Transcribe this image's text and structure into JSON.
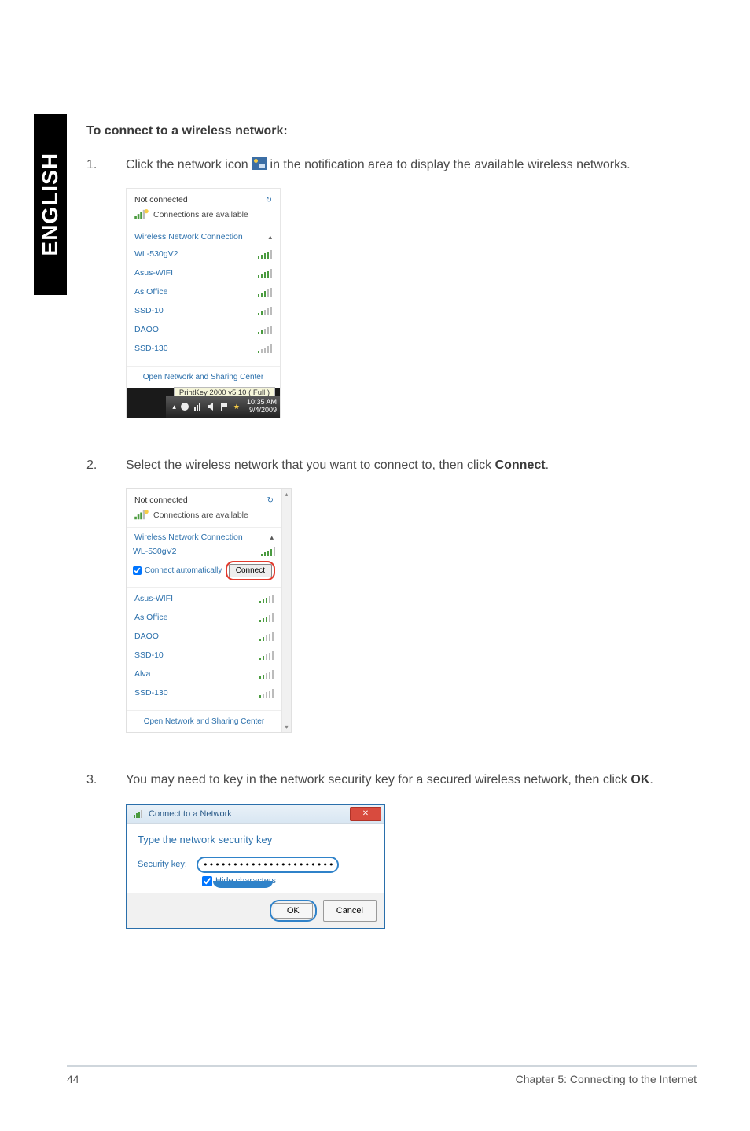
{
  "sideTab": "ENGLISH",
  "heading": "To connect to a wireless network:",
  "steps": {
    "s1": {
      "num": "1.",
      "pre": "Click the network icon ",
      "post": " in the notification area to display the available wireless networks."
    },
    "s2": {
      "num": "2.",
      "text_a": "Select the wireless network that you want to connect to, then click ",
      "bold": "Connect",
      "text_b": "."
    },
    "s3": {
      "num": "3.",
      "text_a": "You may need to key in the network security key for a secured wireless network, then click ",
      "bold": "OK",
      "text_b": "."
    }
  },
  "shot1": {
    "notConnected": "Not connected",
    "connAvail": "Connections are available",
    "section": "Wireless Network Connection",
    "networks": [
      {
        "name": "WL-530gV2",
        "strength": 4
      },
      {
        "name": "Asus-WIFI",
        "strength": 4
      },
      {
        "name": "As Office",
        "strength": 3
      },
      {
        "name": "SSD-10",
        "strength": 2
      },
      {
        "name": "DAOO",
        "strength": 2
      },
      {
        "name": "SSD-130",
        "strength": 1
      }
    ],
    "footer": "Open Network and Sharing Center",
    "tooltip": "PrintKey 2000  v5.10 ( Full )",
    "time": "10:35 AM",
    "date": "9/4/2009"
  },
  "shot2": {
    "notConnected": "Not connected",
    "connAvail": "Connections are available",
    "section": "Wireless Network Connection",
    "selected": {
      "name": "WL-530gV2",
      "auto": "Connect automatically",
      "btn": "Connect",
      "strength": 4
    },
    "networks": [
      {
        "name": "Asus-WIFI",
        "strength": 3
      },
      {
        "name": "As Office",
        "strength": 3
      },
      {
        "name": "DAOO",
        "strength": 2
      },
      {
        "name": "SSD-10",
        "strength": 2
      },
      {
        "name": "Alva",
        "strength": 2
      },
      {
        "name": "SSD-130",
        "strength": 1
      }
    ],
    "footer": "Open Network and Sharing Center"
  },
  "shot3": {
    "title": "Connect to a Network",
    "heading": "Type the network security key",
    "label": "Security key:",
    "value": "••••••••••••••••••••••",
    "hide": "Hide characters",
    "ok": "OK",
    "cancel": "Cancel"
  },
  "footer": {
    "page": "44",
    "chapter": "Chapter 5: Connecting to the Internet"
  }
}
